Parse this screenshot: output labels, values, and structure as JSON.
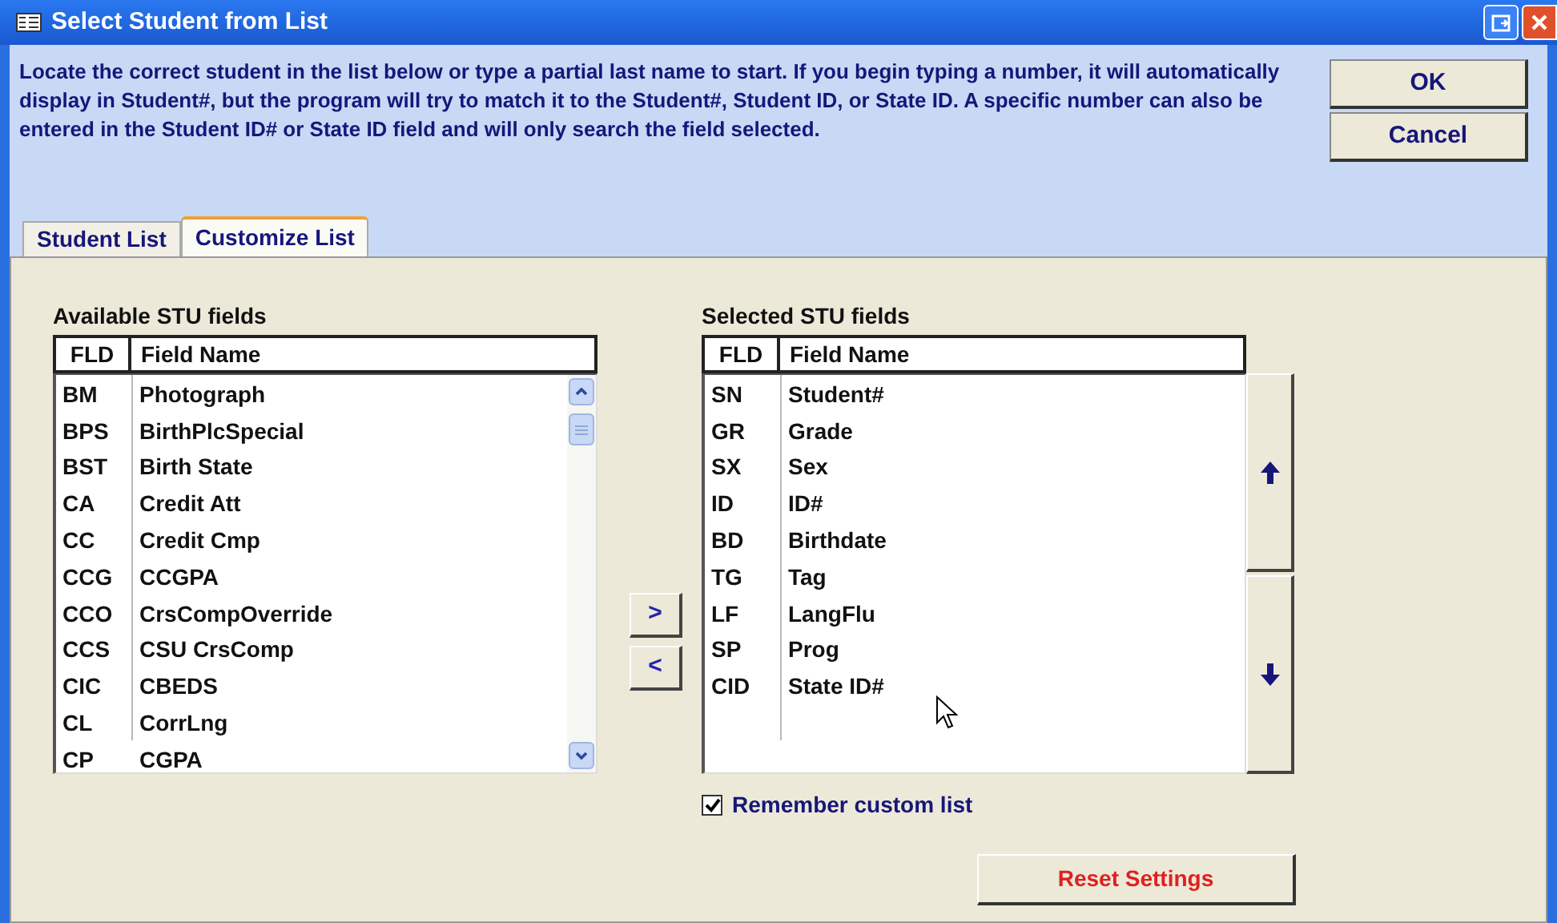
{
  "window": {
    "title": "Select Student from List"
  },
  "instructions": "Locate the correct student in the list below or type a partial last name to start.  If you begin typing a number, it will automatically display in Student#, but the program will try to match it to the Student#, Student ID, or State ID.  A specific number can also be entered in the Student ID# or State ID field and will only search the field selected.",
  "buttons": [
    {
      "label": "OK"
    },
    {
      "label": "Cancel"
    }
  ],
  "tabs": [
    {
      "label": "Student List",
      "selected": false
    },
    {
      "label": "Customize List",
      "selected": true
    }
  ],
  "available": {
    "title": "Available STU fields",
    "columns": [
      "FLD",
      "Field Name"
    ],
    "rows": [
      {
        "fld": "BM",
        "name": "Photograph"
      },
      {
        "fld": "BPS",
        "name": "BirthPlcSpecial"
      },
      {
        "fld": "BST",
        "name": "Birth State"
      },
      {
        "fld": "CA",
        "name": "Credit Att"
      },
      {
        "fld": "CC",
        "name": "Credit Cmp"
      },
      {
        "fld": "CCG",
        "name": "CCGPA"
      },
      {
        "fld": "CCO",
        "name": "CrsCompOverride"
      },
      {
        "fld": "CCS",
        "name": "CSU CrsComp"
      },
      {
        "fld": "CIC",
        "name": "CBEDS"
      },
      {
        "fld": "CL",
        "name": "CorrLng"
      },
      {
        "fld": "CP",
        "name": "CGPA"
      }
    ]
  },
  "move_buttons": [
    ">",
    "<"
  ],
  "selected_fields": {
    "title": "Selected STU fields",
    "columns": [
      "FLD",
      "Field Name"
    ],
    "rows": [
      {
        "fld": "SN",
        "name": "Student#"
      },
      {
        "fld": "GR",
        "name": "Grade"
      },
      {
        "fld": "SX",
        "name": "Sex"
      },
      {
        "fld": "ID",
        "name": "ID#"
      },
      {
        "fld": "BD",
        "name": "Birthdate"
      },
      {
        "fld": "TG",
        "name": "Tag"
      },
      {
        "fld": "LF",
        "name": "LangFlu"
      },
      {
        "fld": "SP",
        "name": "Prog"
      },
      {
        "fld": "CID",
        "name": "State ID#"
      }
    ]
  },
  "remember": {
    "label": "Remember custom list",
    "checked": true
  },
  "reset_button": "Reset Settings"
}
